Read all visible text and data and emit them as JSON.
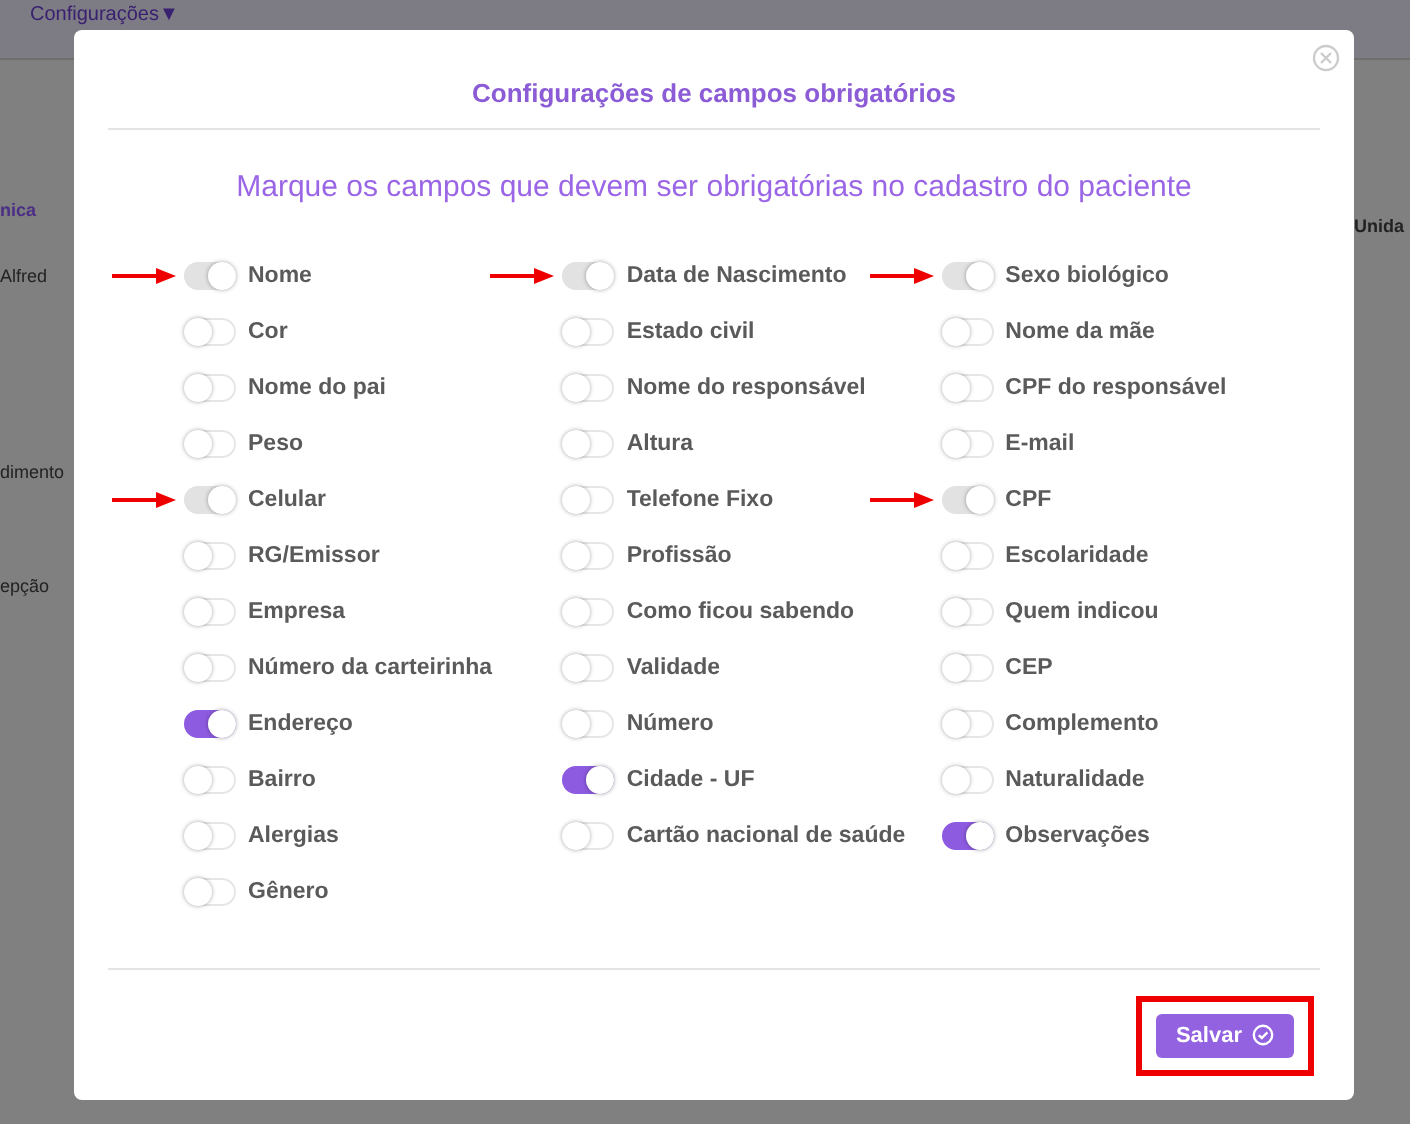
{
  "top_bar": {
    "menu": "Configurações",
    "caret": "▼"
  },
  "background_fragments": {
    "left": [
      "nica",
      "Alfred",
      "dimento",
      "epção"
    ],
    "right": [
      "Unida"
    ]
  },
  "modal": {
    "title": "Configurações de campos obrigatórios",
    "subtitle": "Marque os campos que devem ser obrigatórias no cadastro do paciente",
    "columns": [
      [
        {
          "label": "Nome",
          "on": true,
          "disabled": true,
          "arrow": true
        },
        {
          "label": "Cor",
          "on": false,
          "disabled": false,
          "arrow": false
        },
        {
          "label": "Nome do pai",
          "on": false,
          "disabled": false,
          "arrow": false
        },
        {
          "label": "Peso",
          "on": false,
          "disabled": false,
          "arrow": false
        },
        {
          "label": "Celular",
          "on": true,
          "disabled": true,
          "arrow": true
        },
        {
          "label": "RG/Emissor",
          "on": false,
          "disabled": false,
          "arrow": false
        },
        {
          "label": "Empresa",
          "on": false,
          "disabled": false,
          "arrow": false
        },
        {
          "label": "Número da carteirinha",
          "on": false,
          "disabled": false,
          "arrow": false
        },
        {
          "label": "Endereço",
          "on": true,
          "disabled": false,
          "arrow": false
        },
        {
          "label": "Bairro",
          "on": false,
          "disabled": false,
          "arrow": false
        },
        {
          "label": "Alergias",
          "on": false,
          "disabled": false,
          "arrow": false
        },
        {
          "label": "Gênero",
          "on": false,
          "disabled": false,
          "arrow": false
        }
      ],
      [
        {
          "label": "Data de Nascimento",
          "on": true,
          "disabled": true,
          "arrow": true
        },
        {
          "label": "Estado civil",
          "on": false,
          "disabled": false,
          "arrow": false
        },
        {
          "label": "Nome do responsável",
          "on": false,
          "disabled": false,
          "arrow": false
        },
        {
          "label": "Altura",
          "on": false,
          "disabled": false,
          "arrow": false
        },
        {
          "label": "Telefone Fixo",
          "on": false,
          "disabled": false,
          "arrow": false
        },
        {
          "label": "Profissão",
          "on": false,
          "disabled": false,
          "arrow": false
        },
        {
          "label": "Como ficou sabendo",
          "on": false,
          "disabled": false,
          "arrow": false
        },
        {
          "label": "Validade",
          "on": false,
          "disabled": false,
          "arrow": false
        },
        {
          "label": "Número",
          "on": false,
          "disabled": false,
          "arrow": false
        },
        {
          "label": "Cidade - UF",
          "on": true,
          "disabled": false,
          "arrow": false
        },
        {
          "label": "Cartão nacional de saúde",
          "on": false,
          "disabled": false,
          "arrow": false
        }
      ],
      [
        {
          "label": "Sexo biológico",
          "on": true,
          "disabled": true,
          "arrow": true
        },
        {
          "label": "Nome da mãe",
          "on": false,
          "disabled": false,
          "arrow": false
        },
        {
          "label": "CPF do responsável",
          "on": false,
          "disabled": false,
          "arrow": false
        },
        {
          "label": "E-mail",
          "on": false,
          "disabled": false,
          "arrow": false
        },
        {
          "label": "CPF",
          "on": true,
          "disabled": true,
          "arrow": true
        },
        {
          "label": "Escolaridade",
          "on": false,
          "disabled": false,
          "arrow": false
        },
        {
          "label": "Quem indicou",
          "on": false,
          "disabled": false,
          "arrow": false
        },
        {
          "label": "CEP",
          "on": false,
          "disabled": false,
          "arrow": false
        },
        {
          "label": "Complemento",
          "on": false,
          "disabled": false,
          "arrow": false
        },
        {
          "label": "Naturalidade",
          "on": false,
          "disabled": false,
          "arrow": false
        },
        {
          "label": "Observações",
          "on": true,
          "disabled": false,
          "arrow": false
        }
      ]
    ],
    "save_button": {
      "label": "Salvar",
      "highlighted": true
    }
  }
}
